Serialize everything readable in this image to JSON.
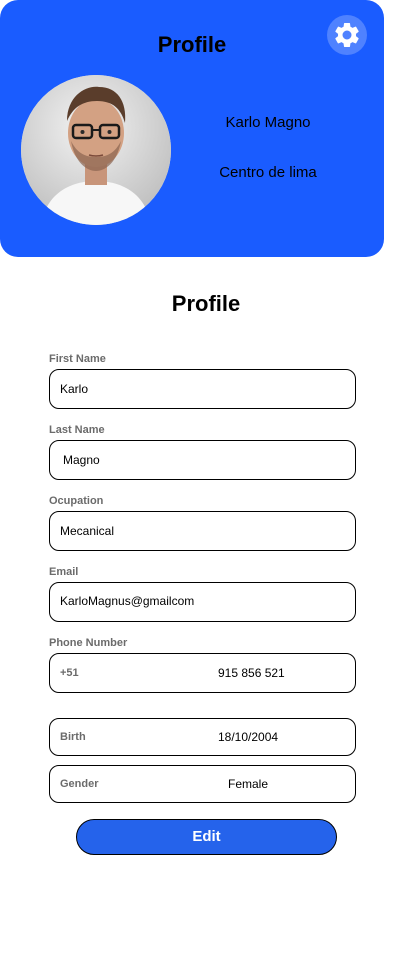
{
  "header": {
    "title": "Profile",
    "name": "Karlo Magno",
    "location": "Centro de lima",
    "settings_icon": "gear-icon",
    "accent_color": "#1a5cff"
  },
  "form": {
    "title": "Profile",
    "first_name": {
      "label": "First Name",
      "value": "Karlo"
    },
    "last_name": {
      "label": "Last Name",
      "value": "Magno"
    },
    "occupation": {
      "label": "Ocupation",
      "value": "Mecanical"
    },
    "email": {
      "label": "Email",
      "value": "KarloMagnus@gmailcom"
    },
    "phone": {
      "label": "Phone Number",
      "prefix": "+51",
      "value": "915 856 521"
    },
    "birth": {
      "label": "Birth",
      "value": "18/10/2004"
    },
    "gender": {
      "label": "Gender",
      "value": "Female"
    },
    "edit_label": "Edit",
    "button_color": "#2563eb"
  }
}
